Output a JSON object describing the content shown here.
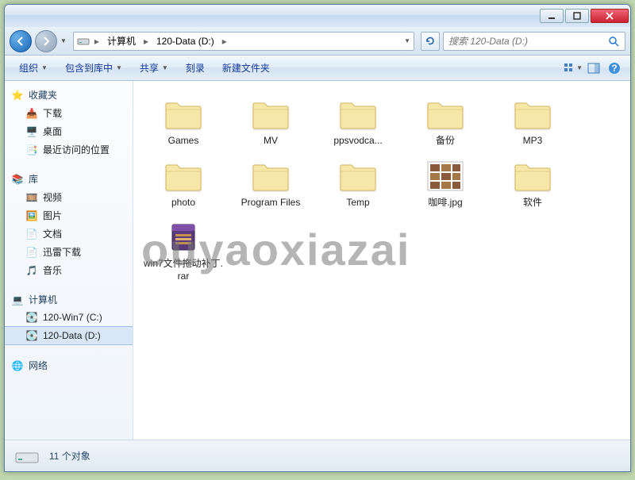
{
  "breadcrumbs": {
    "root": "计算机",
    "current": "120-Data (D:)"
  },
  "search": {
    "placeholder": "搜索 120-Data (D:)"
  },
  "toolbar": {
    "organize": "组织",
    "include": "包含到库中",
    "share": "共享",
    "burn": "刻录",
    "newfolder": "新建文件夹"
  },
  "sidebar": {
    "favorites": {
      "title": "收藏夹",
      "items": [
        "下载",
        "桌面",
        "最近访问的位置"
      ]
    },
    "libraries": {
      "title": "库",
      "items": [
        "视频",
        "图片",
        "文档",
        "迅雷下载",
        "音乐"
      ]
    },
    "computer": {
      "title": "计算机",
      "items": [
        "120-Win7 (C:)",
        "120-Data (D:)"
      ]
    },
    "network": {
      "title": "网络"
    }
  },
  "files": [
    {
      "name": "Games",
      "type": "folder"
    },
    {
      "name": "MV",
      "type": "folder"
    },
    {
      "name": "ppsvodca...",
      "type": "folder"
    },
    {
      "name": "备份",
      "type": "folder"
    },
    {
      "name": "MP3",
      "type": "folder"
    },
    {
      "name": "photo",
      "type": "folder"
    },
    {
      "name": "Program Files",
      "type": "folder"
    },
    {
      "name": "Temp",
      "type": "folder"
    },
    {
      "name": "咖啡.jpg",
      "type": "image"
    },
    {
      "name": "软件",
      "type": "folder"
    },
    {
      "name": "win7文件拖动补丁.rar",
      "type": "rar"
    }
  ],
  "status": {
    "count": "11 个对象"
  },
  "watermark": "ouyaoxiazai"
}
